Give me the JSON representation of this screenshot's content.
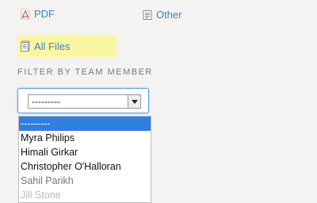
{
  "links": {
    "pdf_label": "PDF",
    "other_label": "Other",
    "all_files_label": "All Files"
  },
  "filter": {
    "heading": "FILTER BY TEAM MEMBER",
    "selected_value": "---------",
    "options": [
      "---------",
      "Myra Philips",
      "Himali Girkar",
      "Christopher O'Halloran",
      "Sahil Parikh",
      "Jill Stone"
    ]
  },
  "colors": {
    "link": "#3a86c7",
    "highlight": "#fbf6a1",
    "selected_option_bg": "#2f7fe0",
    "pdf_icon": "#d13b2f"
  },
  "icons": {
    "pdf": "pdf-icon",
    "other": "document-icon",
    "all_files": "files-icon"
  }
}
